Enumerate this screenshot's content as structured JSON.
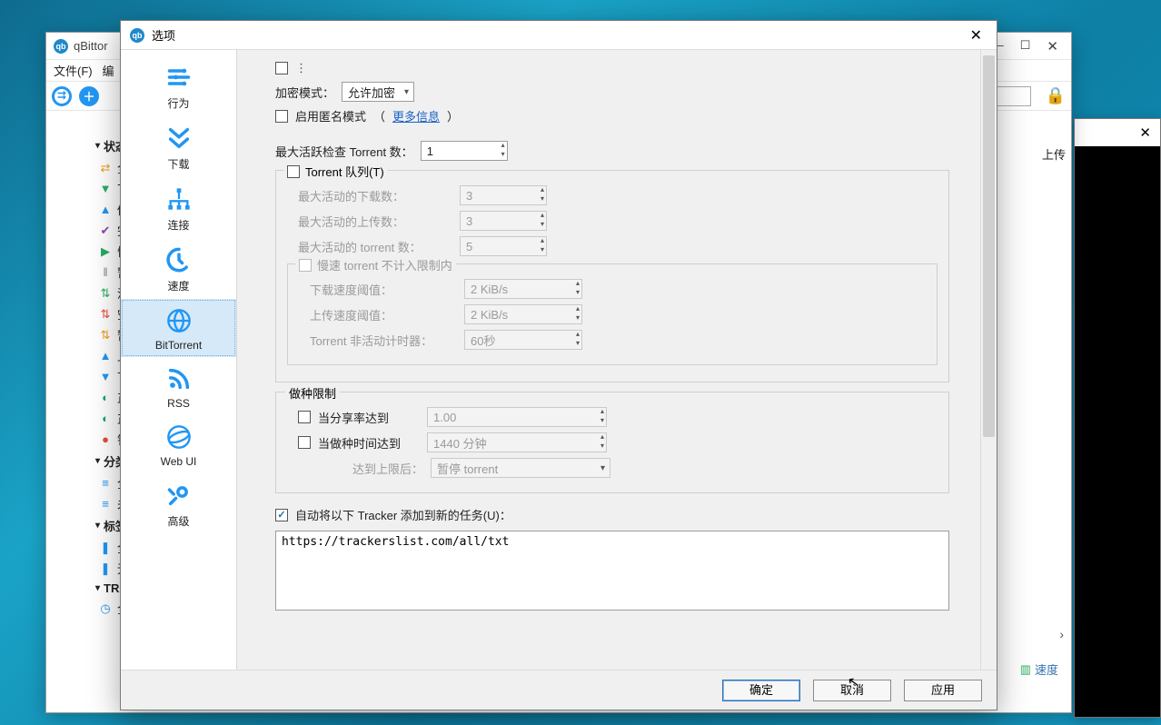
{
  "main": {
    "title": "qBittor",
    "menu_file": "文件(F)",
    "upload_head": "上传",
    "speed_tab": "速度"
  },
  "sidebar": {
    "status": "状态",
    "items_status": [
      {
        "label": "全部 (",
        "ico": "⇄",
        "cls": "c-orange"
      },
      {
        "label": "下载 (",
        "ico": "▼",
        "cls": "c-green"
      },
      {
        "label": "做种 (",
        "ico": "▲",
        "cls": "c-blue"
      },
      {
        "label": "完成 (",
        "ico": "✔",
        "cls": "c-purp"
      },
      {
        "label": "恢复 (",
        "ico": "▶",
        "cls": "c-green"
      },
      {
        "label": "暂停 (",
        "ico": "‖",
        "cls": "c-gray"
      },
      {
        "label": "活动 (",
        "ico": "⇅",
        "cls": "c-green"
      },
      {
        "label": "空闲 (",
        "ico": "⇅",
        "cls": "c-red"
      },
      {
        "label": "暂停 (",
        "ico": "⇅",
        "cls": "c-orange"
      },
      {
        "label": "上传已",
        "ico": "▲",
        "cls": "c-blue"
      },
      {
        "label": "下载已",
        "ico": "▼",
        "cls": "c-blue"
      },
      {
        "label": "正在检",
        "ico": "◐",
        "cls": "c-teal"
      },
      {
        "label": "正在移",
        "ico": "◐",
        "cls": "c-teal"
      },
      {
        "label": "错误 (",
        "ico": "●",
        "cls": "c-red"
      }
    ],
    "cat": "分类",
    "items_cat": [
      {
        "label": "全部 (",
        "ico": "≡",
        "cls": "c-blue"
      },
      {
        "label": "未分类",
        "ico": "≡",
        "cls": "c-blue"
      }
    ],
    "tag": "标签",
    "items_tag": [
      {
        "label": "全部 (",
        "ico": "❚",
        "cls": "c-blue"
      },
      {
        "label": "无标签",
        "ico": "❚",
        "cls": "c-blue"
      }
    ],
    "tracker": "TRACKER",
    "items_tracker": [
      {
        "label": "全部 (",
        "ico": "◷",
        "cls": "c-blue"
      }
    ]
  },
  "dialog": {
    "title": "选项",
    "categories": [
      "行为",
      "下载",
      "连接",
      "速度",
      "BitTorrent",
      "RSS",
      "Web UI",
      "高级"
    ],
    "selected_index": 4,
    "encrypt_label": "加密模式：",
    "encrypt_value": "允许加密",
    "anon_label": "启用匿名模式",
    "more_info": "更多信息",
    "max_active_check": "最大活跃检查 Torrent 数：",
    "max_active_check_value": "1",
    "queue_legend": "Torrent 队列(T)",
    "max_dl": "最大活动的下载数：",
    "max_dl_v": "3",
    "max_ul": "最大活动的上传数：",
    "max_ul_v": "3",
    "max_t": "最大活动的 torrent 数：",
    "max_t_v": "5",
    "slow_legend": "慢速 torrent 不计入限制内",
    "dl_thresh": "下载速度阈值：",
    "dl_thresh_v": "2 KiB/s",
    "ul_thresh": "上传速度阈值：",
    "ul_thresh_v": "2 KiB/s",
    "inact": "Torrent 非活动计时器：",
    "inact_v": "60秒",
    "seed_legend": "做种限制",
    "ratio_lbl": "当分享率达到",
    "ratio_v": "1.00",
    "seedtime_lbl": "当做种时间达到",
    "seedtime_v": "1440 分钟",
    "reach_lbl": "达到上限后：",
    "reach_v": "暂停 torrent",
    "auto_tracker_lbl": "自动将以下 Tracker 添加到新的任务(U)：",
    "trackers_text": "https://trackerslist.com/all/txt",
    "ok": "确定",
    "cancel": "取消",
    "apply": "应用"
  }
}
